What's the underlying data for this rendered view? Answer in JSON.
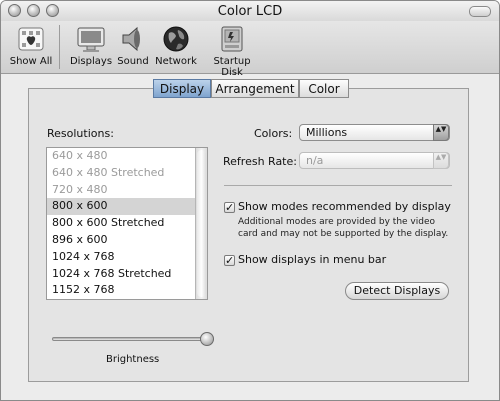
{
  "window": {
    "title": "Color LCD"
  },
  "toolbar": {
    "show_all": "Show All",
    "displays": "Displays",
    "sound": "Sound",
    "network": "Network",
    "startup_disk": "Startup Disk"
  },
  "tabs": [
    {
      "label": "Display",
      "active": true
    },
    {
      "label": "Arrangement",
      "active": false
    },
    {
      "label": "Color",
      "active": false
    }
  ],
  "resolutions": {
    "label": "Resolutions:",
    "items": [
      {
        "text": "640 x 480",
        "state": "disabled"
      },
      {
        "text": "640 x 480 Stretched",
        "state": "disabled"
      },
      {
        "text": "720 x 480",
        "state": "disabled"
      },
      {
        "text": "800 x 600",
        "state": "selected"
      },
      {
        "text": "800 x 600 Stretched",
        "state": "normal"
      },
      {
        "text": "896 x 600",
        "state": "normal"
      },
      {
        "text": "1024 x 768",
        "state": "normal"
      },
      {
        "text": "1024 x 768 Stretched",
        "state": "normal"
      },
      {
        "text": "1152 x 768",
        "state": "normal"
      }
    ]
  },
  "colors": {
    "label": "Colors:",
    "value": "Millions"
  },
  "refresh": {
    "label": "Refresh Rate:",
    "value": "n/a"
  },
  "options": {
    "show_modes": {
      "label": "Show modes recommended by display",
      "checked": true
    },
    "modes_note_line1": "Additional modes are provided by the video",
    "modes_note_line2": "card and may not be supported by the display.",
    "show_menu": {
      "label": "Show displays in menu bar",
      "checked": true
    }
  },
  "detect_button": "Detect Displays",
  "brightness": {
    "label": "Brightness",
    "level": 1.0
  },
  "symbols": {
    "check": "✓",
    "arrows": "▲▼"
  }
}
